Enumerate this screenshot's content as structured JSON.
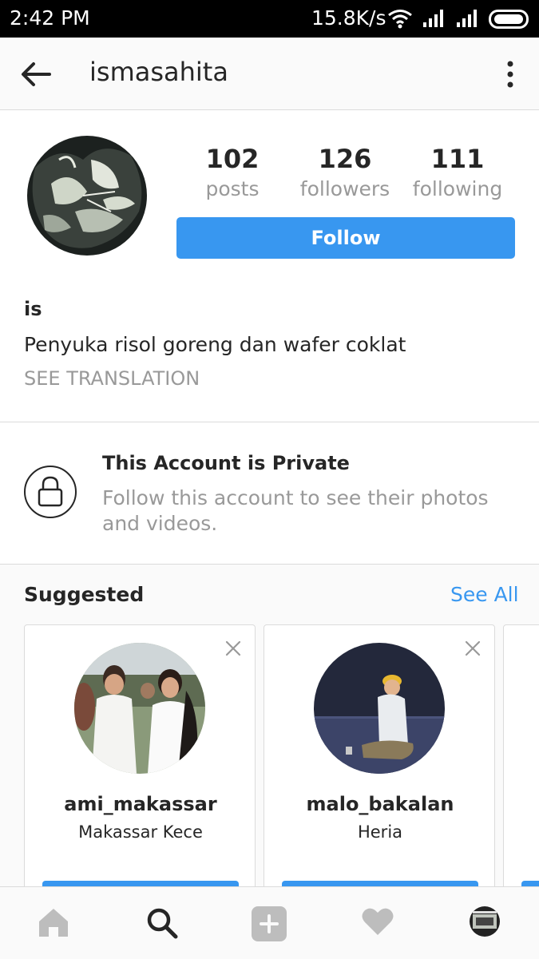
{
  "status_bar": {
    "time": "2:42  PM",
    "net_speed": "15.8K/s"
  },
  "app_bar": {
    "username": "ismasahita"
  },
  "profile": {
    "stats": [
      {
        "value": "102",
        "label": "posts"
      },
      {
        "value": "126",
        "label": "followers"
      },
      {
        "value": "111",
        "label": "following"
      }
    ],
    "follow_label": "Follow",
    "name": "is",
    "bio": "Penyuka risol goreng dan wafer coklat",
    "see_translation": "SEE TRANSLATION"
  },
  "private": {
    "title": "This Account is Private",
    "description": "Follow this account to see their photos and videos."
  },
  "suggested": {
    "title": "Suggested",
    "see_all": "See All",
    "cards": [
      {
        "username": "ami_makassar",
        "full_name": "Makassar Kece"
      },
      {
        "username": "malo_bakalan",
        "full_name": "Heria"
      }
    ]
  },
  "bottom_nav": {
    "items": [
      "home-icon",
      "search-icon",
      "add-post-icon",
      "heart-icon",
      "profile-avatar"
    ]
  },
  "colors": {
    "accent": "#3897f0",
    "muted_text": "#999999",
    "text": "#262626"
  }
}
